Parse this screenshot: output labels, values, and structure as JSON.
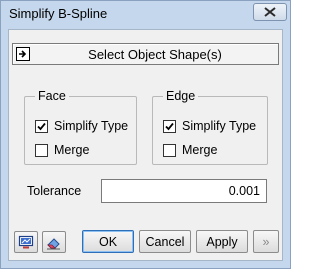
{
  "window": {
    "title": "Simplify B-Spline"
  },
  "select_object": {
    "label": "Select Object Shape(s)"
  },
  "face_group": {
    "legend": "Face",
    "simplify_type_label": "Simplify Type",
    "simplify_type_checked": true,
    "merge_label": "Merge",
    "merge_checked": false
  },
  "edge_group": {
    "legend": "Edge",
    "simplify_type_label": "Simplify Type",
    "simplify_type_checked": true,
    "merge_label": "Merge",
    "merge_checked": false
  },
  "tolerance": {
    "label": "Tolerance",
    "value": "0.001"
  },
  "buttons": {
    "ok": "OK",
    "cancel": "Cancel",
    "apply": "Apply",
    "more": "»"
  },
  "icons": {
    "close": "close-icon",
    "select_arrow": "arrow-right-icon",
    "preview": "preview-icon",
    "eraser": "eraser-icon"
  },
  "colors": {
    "frame": "#c5d7ec",
    "client": "#f0f0f0",
    "default_button_border": "#2f6fb7"
  }
}
